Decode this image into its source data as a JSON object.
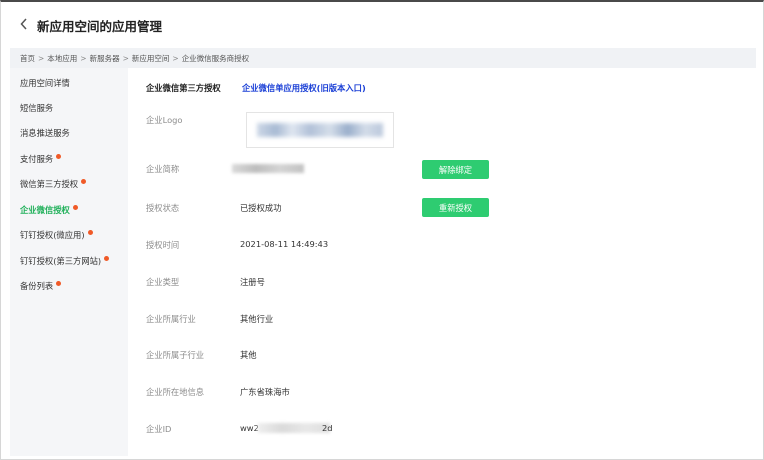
{
  "header": {
    "title": "新应用空间的应用管理"
  },
  "breadcrumb": [
    "首页",
    "本地应用",
    "新服务器",
    "新应用空间",
    "企业微信服务商授权"
  ],
  "breadcrumb_separator": ">",
  "sidebar": {
    "items": [
      {
        "label": "应用空间详情",
        "dot": false,
        "active": false
      },
      {
        "label": "短信服务",
        "dot": false,
        "active": false
      },
      {
        "label": "消息推送服务",
        "dot": false,
        "active": false
      },
      {
        "label": "支付服务",
        "dot": true,
        "active": false
      },
      {
        "label": "微信第三方授权",
        "dot": true,
        "active": false
      },
      {
        "label": "企业微信授权",
        "dot": true,
        "active": true
      },
      {
        "label": "钉钉授权(微应用)",
        "dot": true,
        "active": false
      },
      {
        "label": "钉钉授权(第三方网站)",
        "dot": true,
        "active": false
      },
      {
        "label": "备份列表",
        "dot": true,
        "active": false
      }
    ]
  },
  "tabs": {
    "third_party": "企业微信第三方授权",
    "legacy": "企业微信单应用授权(旧版本入口)"
  },
  "fields": {
    "logo_label": "企业Logo",
    "name_label": "企业简称",
    "status_label": "授权状态",
    "status_value": "已授权成功",
    "time_label": "授权时间",
    "time_value": "2021-08-11 14:49:43",
    "type_label": "企业类型",
    "type_value": "注册号",
    "industry_label": "企业所属行业",
    "industry_value": "其他行业",
    "sub_industry_label": "企业所属子行业",
    "sub_industry_value": "其他",
    "location_label": "企业所在地信息",
    "location_value": "广东省珠海市",
    "id_label": "企业ID",
    "id_prefix": "ww2",
    "id_suffix": "2d"
  },
  "buttons": {
    "unbind": "解除绑定",
    "reauthorize": "重新授权"
  },
  "colors": {
    "accent_green": "#2ecc71",
    "active_text": "#20b05a",
    "link_blue": "#1a3fd6",
    "dot": "#f05a28"
  }
}
